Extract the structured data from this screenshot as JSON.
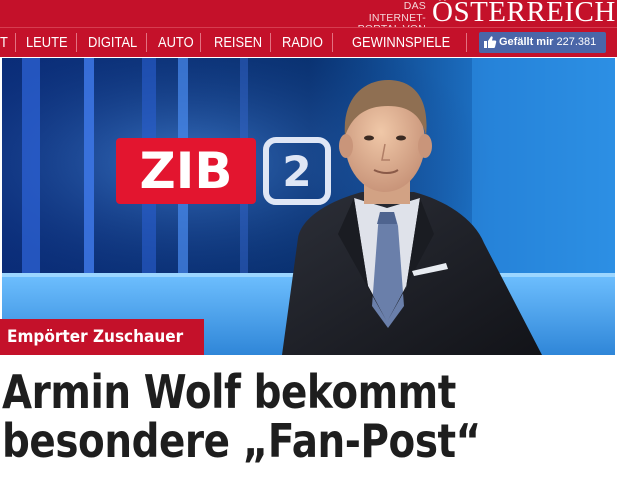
{
  "brand": {
    "tagline_line1": "DAS INTERNET-",
    "tagline_line2": "PORTAL VON",
    "logo": "ÖSTERREICH",
    "color": "#c4112a"
  },
  "nav": {
    "items": [
      {
        "label": "T"
      },
      {
        "label": "LEUTE"
      },
      {
        "label": "DIGITAL"
      },
      {
        "label": "AUTO"
      },
      {
        "label": "REISEN"
      },
      {
        "label": "RADIO"
      },
      {
        "label": "GEWINNSPIELE"
      }
    ],
    "like_button": {
      "icon": "thumbs-up-icon",
      "label": "Gefällt mir",
      "count": "227.381",
      "color": "#4a66a8"
    }
  },
  "hero": {
    "studio_logo_left": "ZIB",
    "studio_logo_right": "2"
  },
  "article": {
    "kicker": "Empörter Zuschauer",
    "headline_line1": "Armin Wolf bekommt",
    "headline_line2": "besondere „Fan-Post“"
  }
}
